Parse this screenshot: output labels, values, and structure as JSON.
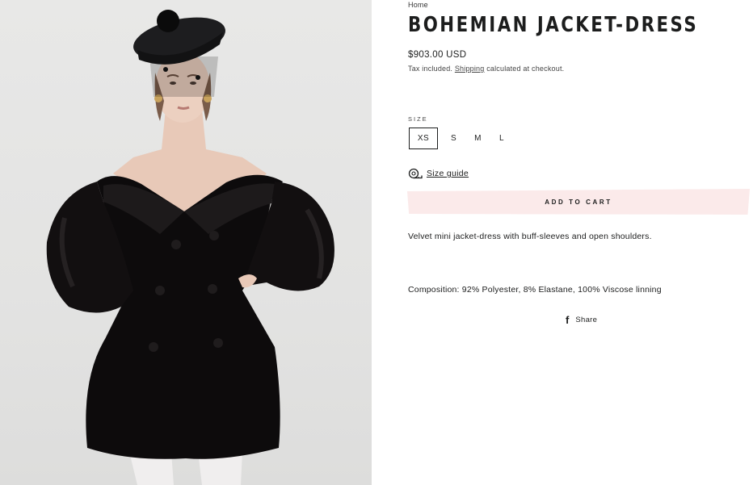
{
  "breadcrumb": {
    "home": "Home"
  },
  "product": {
    "title": "BOHEMIAN JACKET-DRESS",
    "price": "$903.00 USD",
    "tax": {
      "prefix": "Tax included.",
      "link": "Shipping",
      "suffix": "calculated at checkout."
    },
    "size": {
      "label": "SIZE",
      "options": [
        "XS",
        "S",
        "M",
        "L"
      ],
      "selected": "XS"
    },
    "size_guide": {
      "label": "Size guide",
      "icon": "tape-measure-icon"
    },
    "add_to_cart": "ADD TO CART",
    "description": "Velvet mini jacket-dress with buff-sleeves and open shoulders.",
    "composition": "Composition: 92% Polyester, 8% Elastane, 100% Viscose linning",
    "share": {
      "label": "Share",
      "icon": "facebook-icon"
    }
  },
  "colors": {
    "accent_button_bg": "#fbeaea",
    "text": "#1c1d1d",
    "photo_background": "#e5e5e4",
    "dress": "#0d0b0c"
  }
}
